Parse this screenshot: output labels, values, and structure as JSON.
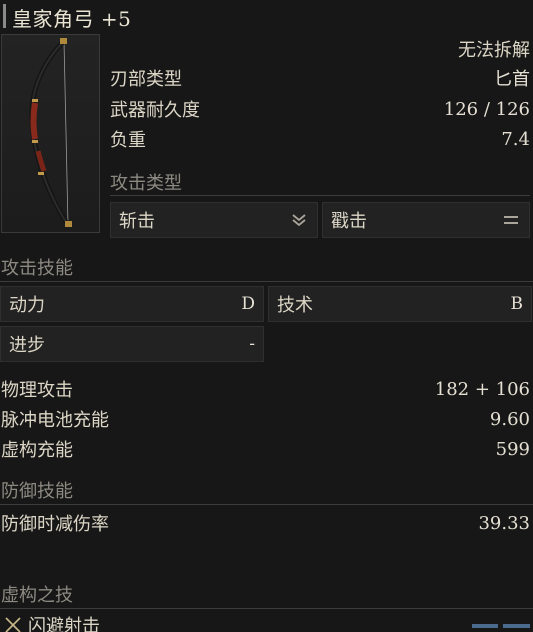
{
  "item": {
    "name": "皇家角弓 +5",
    "unsalvageable": "无法拆解"
  },
  "stats": [
    {
      "label": "刃部类型",
      "value": "匕首"
    },
    {
      "label": "武器耐久度",
      "value": "126 / 126"
    },
    {
      "label": "负重",
      "value": "7.4"
    }
  ],
  "attack_type": {
    "heading": "攻击类型",
    "options": [
      {
        "label": "斩击",
        "icon": "double-chevron-down-icon"
      },
      {
        "label": "戳击",
        "icon": "equals-icon"
      }
    ]
  },
  "attack_skill": {
    "heading": "攻击技能",
    "cells": [
      {
        "label": "动力",
        "grade": "D"
      },
      {
        "label": "技术",
        "grade": "B"
      },
      {
        "label": "进步",
        "grade": "-"
      }
    ]
  },
  "attack_stats": [
    {
      "label": "物理攻击",
      "value": "182 + 106"
    },
    {
      "label": "脉冲电池充能",
      "value": "9.60"
    },
    {
      "label": "虚构充能",
      "value": "599"
    }
  ],
  "defense": {
    "heading": "防御技能",
    "label": "防御时减伤率",
    "value": "39.33"
  },
  "fable_art": {
    "heading": "虚构之技",
    "skill": "闪避射击",
    "icon": "crossed-swords-icon"
  },
  "colors": {
    "background": "#171717",
    "panel": "#222222",
    "text": "#dcd6c6",
    "muted": "#8d8a82",
    "accent": "#4a6b8e"
  }
}
